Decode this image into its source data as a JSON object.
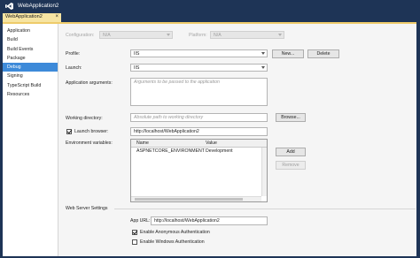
{
  "window": {
    "title": "WebApplication2"
  },
  "doc_tab": {
    "label": "WebApplication2",
    "close": "×"
  },
  "nav": {
    "items": [
      {
        "label": "Application",
        "active": false
      },
      {
        "label": "Build",
        "active": false
      },
      {
        "label": "Build Events",
        "active": false
      },
      {
        "label": "Package",
        "active": false
      },
      {
        "label": "Debug",
        "active": true
      },
      {
        "label": "Signing",
        "active": false
      },
      {
        "label": "TypeScript Build",
        "active": false
      },
      {
        "label": "Resources",
        "active": false
      }
    ]
  },
  "config": {
    "configuration_label": "Configuration:",
    "configuration_value": "N/A",
    "platform_label": "Platform:",
    "platform_value": "N/A"
  },
  "profile": {
    "label": "Profile:",
    "value": "IIS",
    "new_button": "New...",
    "delete_button": "Delete"
  },
  "launch": {
    "label": "Launch:",
    "value": "IIS"
  },
  "app_args": {
    "label": "Application arguments:",
    "placeholder": "Arguments to be passed to the application"
  },
  "working_dir": {
    "label": "Working directory:",
    "placeholder": "Absolute path to working directory",
    "browse_button": "Browse..."
  },
  "launch_browser": {
    "label": "Launch browser:",
    "checked": true,
    "value": "http://localhost/WebApplication2"
  },
  "env_vars": {
    "label": "Environment variables:",
    "columns": [
      "Name",
      "Value"
    ],
    "rows": [
      [
        "ASPNETCORE_ENVIRONMENT",
        "Development"
      ]
    ],
    "add_button": "Add",
    "remove_button": "Remove"
  },
  "web_server": {
    "section_label": "Web Server Settings",
    "app_url_label": "App URL:",
    "app_url_value": "http://localhost/WebApplication2",
    "anonymous_auth_label": "Enable Anonymous Authentication",
    "anonymous_auth_checked": true,
    "windows_auth_label": "Enable Windows Authentication",
    "windows_auth_checked": false
  },
  "colors": {
    "title_bar": "#1e3456",
    "active_tab": "#f6e4a2",
    "nav_selected": "#3d8ad9",
    "panel_background": "#f5f5f5"
  }
}
